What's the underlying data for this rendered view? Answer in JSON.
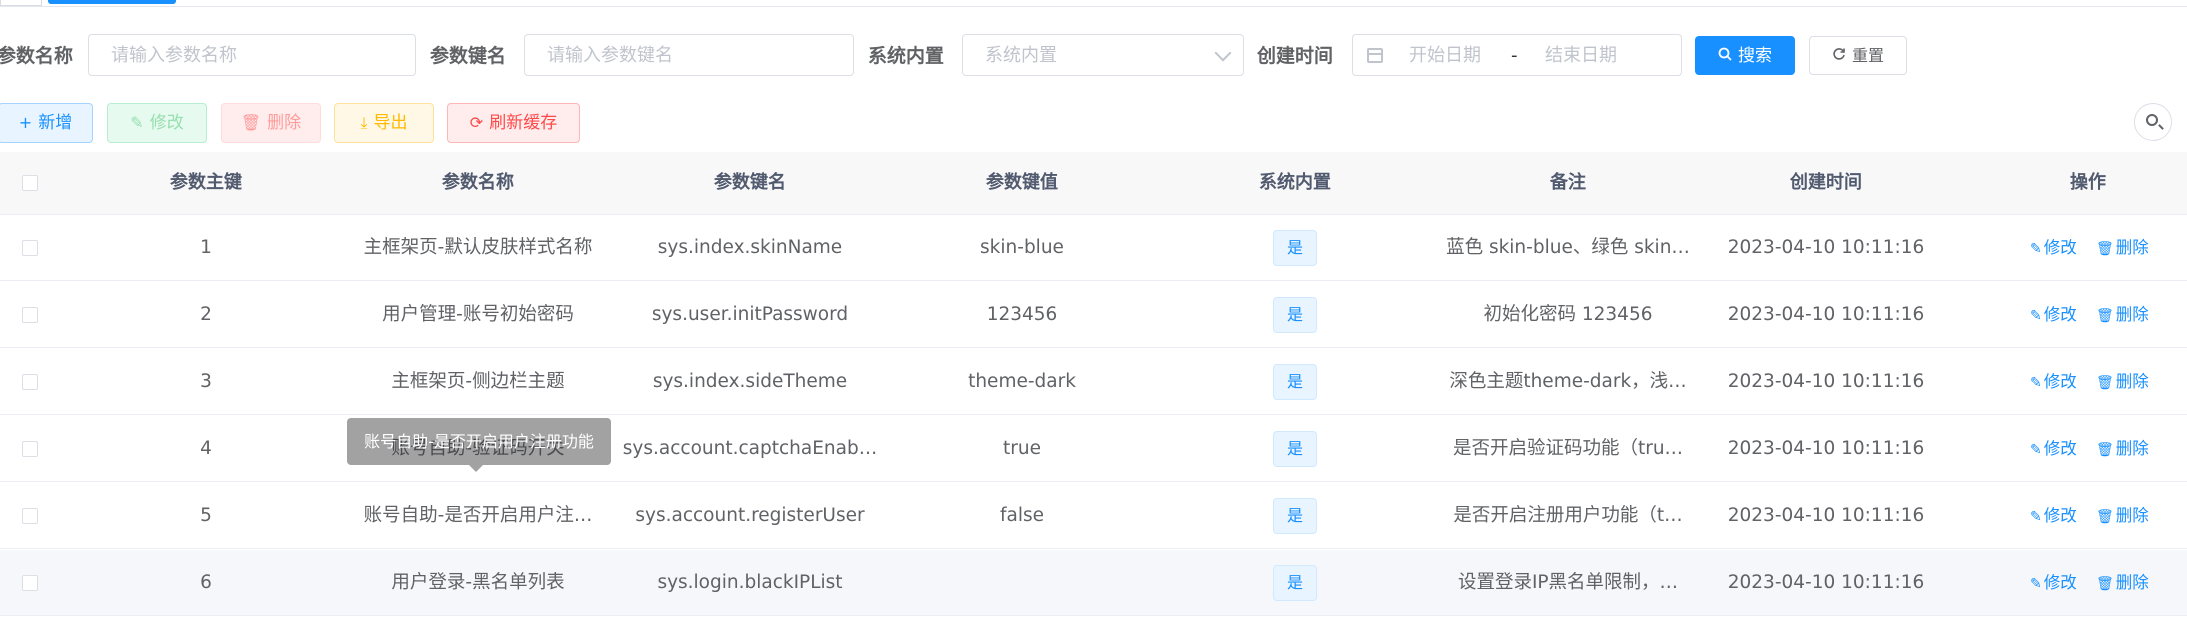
{
  "search": {
    "param_name_label": "参数名称",
    "param_name_placeholder": "请输入参数名称",
    "param_key_label": "参数键名",
    "param_key_placeholder": "请输入参数键名",
    "builtin_label": "系统内置",
    "builtin_placeholder": "系统内置",
    "created_label": "创建时间",
    "start_placeholder": "开始日期",
    "range_separator": "-",
    "end_placeholder": "结束日期",
    "search_button": "搜索",
    "reset_button": "重置"
  },
  "toolbar": {
    "add": "新增",
    "edit": "修改",
    "delete": "删除",
    "export": "导出",
    "refresh_cache": "刷新缓存"
  },
  "table": {
    "headers": [
      "参数主键",
      "参数名称",
      "参数键名",
      "参数键值",
      "系统内置",
      "备注",
      "创建时间",
      "操作"
    ],
    "rows": [
      {
        "id": "1",
        "name": "主框架页-默认皮肤样式名称",
        "key": "sys.index.skinName",
        "value": "skin-blue",
        "builtin": "是",
        "remark": "蓝色 skin-blue、绿色 skin…",
        "created": "2023-04-10 10:11:16",
        "edit": "修改",
        "delete": "删除"
      },
      {
        "id": "2",
        "name": "用户管理-账号初始密码",
        "key": "sys.user.initPassword",
        "value": "123456",
        "builtin": "是",
        "remark": "初始化密码 123456",
        "created": "2023-04-10 10:11:16",
        "edit": "修改",
        "delete": "删除"
      },
      {
        "id": "3",
        "name": "主框架页-侧边栏主题",
        "key": "sys.index.sideTheme",
        "value": "theme-dark",
        "builtin": "是",
        "remark": "深色主题theme-dark，浅…",
        "created": "2023-04-10 10:11:16",
        "edit": "修改",
        "delete": "删除"
      },
      {
        "id": "4",
        "name": "账号自助-验证码开关",
        "key": "sys.account.captchaEnab…",
        "value": "true",
        "builtin": "是",
        "remark": "是否开启验证码功能（tru…",
        "created": "2023-04-10 10:11:16",
        "edit": "修改",
        "delete": "删除"
      },
      {
        "id": "5",
        "name": "账号自助-是否开启用户注…",
        "key": "sys.account.registerUser",
        "value": "false",
        "builtin": "是",
        "remark": "是否开启注册用户功能（t…",
        "created": "2023-04-10 10:11:16",
        "edit": "修改",
        "delete": "删除"
      },
      {
        "id": "6",
        "name": "用户登录-黑名单列表",
        "key": "sys.login.blackIPList",
        "value": "",
        "builtin": "是",
        "remark": "设置登录IP黑名单限制，…",
        "created": "2023-04-10 10:11:16",
        "edit": "修改",
        "delete": "删除"
      }
    ]
  },
  "tooltip": "账号自助-是否开启用户注册功能",
  "icons": {
    "search": "search-icon",
    "refresh": "refresh-icon",
    "plus": "plus-icon",
    "edit": "edit-icon",
    "delete": "delete-icon",
    "download": "download-icon",
    "calendar": "calendar-icon",
    "chevron": "chevron-down-icon"
  },
  "colors": {
    "primary": "#1890ff",
    "success": "#13ce66",
    "danger": "#ff4949",
    "warning": "#ffba00"
  }
}
